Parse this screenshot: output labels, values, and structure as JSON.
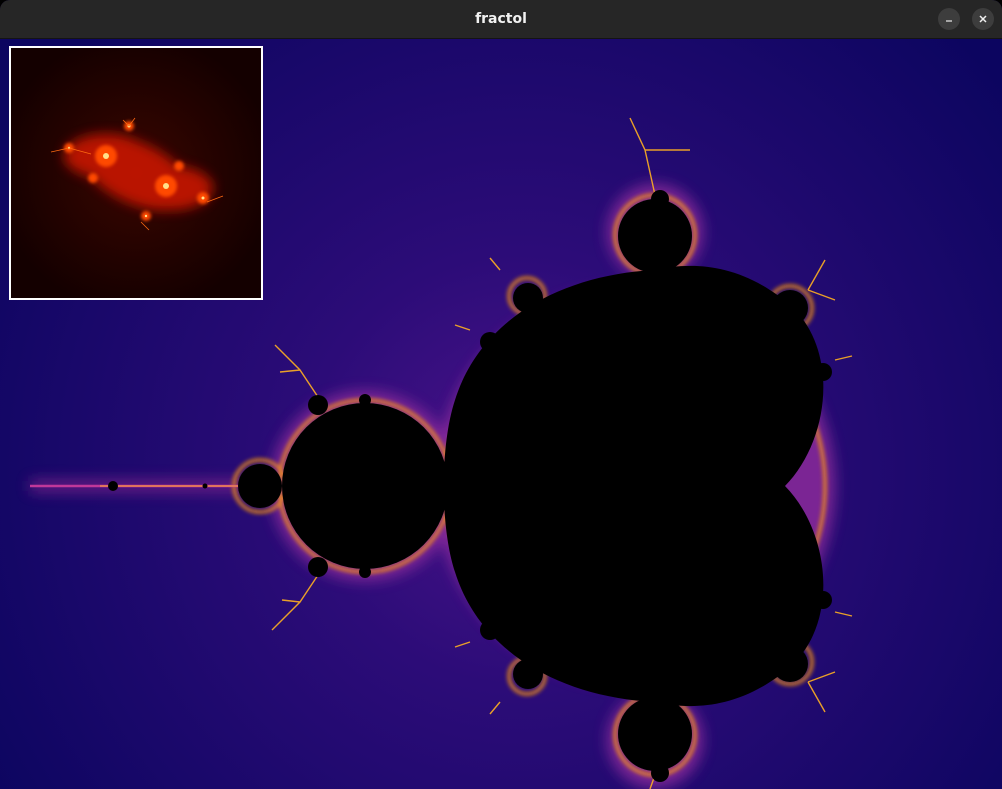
{
  "window": {
    "title": "fractol"
  },
  "controls": {
    "minimize_icon": "minimize-icon",
    "close_icon": "close-icon"
  },
  "fractal": {
    "name": "mandelbrot",
    "palette": {
      "background_outer": "#0c0560",
      "background_inner": "#3a1080",
      "glow": "#ff8a00",
      "edge": "#ffd23a",
      "set": "#000000"
    }
  },
  "preview": {
    "name": "julia",
    "palette": {
      "background": "#140000",
      "glow": "#ff2a00",
      "core": "#ffe08a"
    }
  }
}
